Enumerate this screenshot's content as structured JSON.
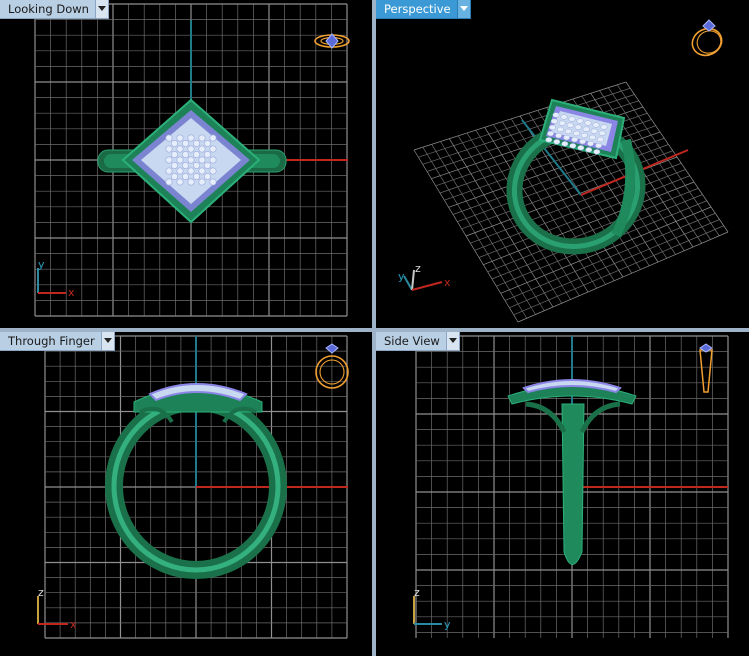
{
  "viewports": {
    "top_left": {
      "title": "Looking Down"
    },
    "top_right": {
      "title": "Perspective",
      "active": true
    },
    "bottom_left": {
      "title": "Through Finger"
    },
    "bottom_right": {
      "title": "Side View"
    }
  },
  "axis_labels": {
    "looking_down": {
      "a": "y",
      "b": "x"
    },
    "perspective": {
      "a": "y",
      "b": "z",
      "c": "x"
    },
    "through_finger": {
      "a": "z",
      "b": "x"
    },
    "side_view": {
      "a": "z",
      "b": "y"
    }
  },
  "colors": {
    "grid": "#6c6c6c",
    "grid_major": "#909090",
    "axis_x": "#c0271f",
    "axis_y": "#1f7a8a",
    "ring_metal": "#1f8a5c",
    "gem": "#c8d8f0",
    "gem_halo": "#8b85e6",
    "active_tab": "#3b9ad6",
    "nav_icon": "#f0a030"
  },
  "icons": {
    "tab_dropdown": "dropdown-arrow-icon",
    "view_cube": "ring-navigation-icon"
  }
}
